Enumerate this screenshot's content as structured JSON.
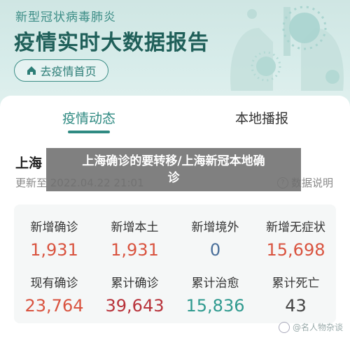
{
  "header": {
    "sub_title": "新型冠状病毒肺炎",
    "title": "疫情实时大数据报告",
    "home_button": "去疫情首页",
    "home_icon": "home-icon"
  },
  "tabs": [
    {
      "label": "疫情动态",
      "active": true
    },
    {
      "label": "本地播报",
      "active": false
    }
  ],
  "region": "上海",
  "updated": "更新至 2022.04.22 21:01",
  "explain": "数据说明",
  "stats": [
    {
      "label": "新增确诊",
      "value": "1,931",
      "color": "#d9533f"
    },
    {
      "label": "新增本土",
      "value": "1,931",
      "color": "#d9533f"
    },
    {
      "label": "新增境外",
      "value": "0",
      "color": "#4a6f9a"
    },
    {
      "label": "新增无症状",
      "value": "15,698",
      "color": "#d9533f"
    },
    {
      "label": "现有确诊",
      "value": "23,764",
      "color": "#d9533f"
    },
    {
      "label": "累计确诊",
      "value": "39,643",
      "color": "#b8323a"
    },
    {
      "label": "累计治愈",
      "value": "15,836",
      "color": "#2f9a8f"
    },
    {
      "label": "累计死亡",
      "value": "43",
      "color": "#444444"
    }
  ],
  "overlay": {
    "line1": "上海确诊的要转移/上海新冠本地确",
    "line2": "诊"
  },
  "watermark": "@名人物杂谈"
}
